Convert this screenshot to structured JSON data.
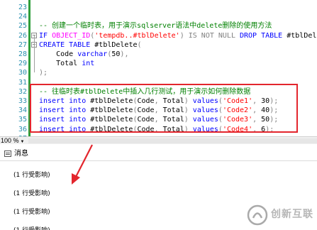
{
  "editor": {
    "lines": [
      {
        "n": "23"
      },
      {
        "n": "24"
      },
      {
        "n": "25",
        "parts": [
          {
            "t": "-- 创建一个临时表，用于演示sqlserver语法中delete删除的使用方法",
            "c": "cm"
          }
        ]
      },
      {
        "n": "26",
        "parts": [
          {
            "t": "IF ",
            "c": "kw"
          },
          {
            "t": "OBJECT_ID",
            "c": "fn"
          },
          {
            "t": "(",
            "c": "gr"
          },
          {
            "t": "'tempdb..#tblDelete'",
            "c": "str"
          },
          {
            "t": ") ",
            "c": "gr"
          },
          {
            "t": "IS NOT NULL ",
            "c": "gr"
          },
          {
            "t": "DROP TABLE ",
            "c": "kw"
          },
          {
            "t": "#tblDelete;",
            "c": "num"
          }
        ]
      },
      {
        "n": "27",
        "parts": [
          {
            "t": "CREATE TABLE ",
            "c": "kw"
          },
          {
            "t": "#tblDelete",
            "c": "num"
          },
          {
            "t": "(",
            "c": "gr"
          }
        ]
      },
      {
        "n": "28",
        "parts": [
          {
            "t": "    Code ",
            "c": "num"
          },
          {
            "t": "varchar",
            "c": "kw"
          },
          {
            "t": "(",
            "c": "gr"
          },
          {
            "t": "50",
            "c": "num"
          },
          {
            "t": "),",
            "c": "gr"
          }
        ]
      },
      {
        "n": "29",
        "parts": [
          {
            "t": "    Total ",
            "c": "num"
          },
          {
            "t": "int",
            "c": "kw"
          }
        ]
      },
      {
        "n": "30",
        "parts": [
          {
            "t": ");",
            "c": "gr"
          }
        ]
      },
      {
        "n": "31"
      },
      {
        "n": "32",
        "parts": [
          {
            "t": "-- 往临时表#tblDelete中插入几行测试，用于演示如何删除数据",
            "c": "cm"
          }
        ]
      },
      {
        "n": "33",
        "parts": [
          {
            "t": "insert into ",
            "c": "kw"
          },
          {
            "t": "#tblDelete",
            "c": "num"
          },
          {
            "t": "(",
            "c": "gr"
          },
          {
            "t": "Code",
            "c": "num"
          },
          {
            "t": ", ",
            "c": "gr"
          },
          {
            "t": "Total",
            "c": "num"
          },
          {
            "t": ") ",
            "c": "gr"
          },
          {
            "t": "values",
            "c": "kw"
          },
          {
            "t": "(",
            "c": "gr"
          },
          {
            "t": "'Code1'",
            "c": "str"
          },
          {
            "t": ", ",
            "c": "gr"
          },
          {
            "t": "30",
            "c": "num"
          },
          {
            "t": ");",
            "c": "gr"
          }
        ]
      },
      {
        "n": "34",
        "parts": [
          {
            "t": "insert into ",
            "c": "kw"
          },
          {
            "t": "#tblDelete",
            "c": "num"
          },
          {
            "t": "(",
            "c": "gr"
          },
          {
            "t": "Code",
            "c": "num"
          },
          {
            "t": ", ",
            "c": "gr"
          },
          {
            "t": "Total",
            "c": "num"
          },
          {
            "t": ") ",
            "c": "gr"
          },
          {
            "t": "values",
            "c": "kw"
          },
          {
            "t": "(",
            "c": "gr"
          },
          {
            "t": "'Code2'",
            "c": "str"
          },
          {
            "t": ", ",
            "c": "gr"
          },
          {
            "t": "40",
            "c": "num"
          },
          {
            "t": ");",
            "c": "gr"
          }
        ]
      },
      {
        "n": "35",
        "parts": [
          {
            "t": "insert into ",
            "c": "kw"
          },
          {
            "t": "#tblDelete",
            "c": "num"
          },
          {
            "t": "(",
            "c": "gr"
          },
          {
            "t": "Code",
            "c": "num"
          },
          {
            "t": ", ",
            "c": "gr"
          },
          {
            "t": "Total",
            "c": "num"
          },
          {
            "t": ") ",
            "c": "gr"
          },
          {
            "t": "values",
            "c": "kw"
          },
          {
            "t": "(",
            "c": "gr"
          },
          {
            "t": "'Code3'",
            "c": "str"
          },
          {
            "t": ", ",
            "c": "gr"
          },
          {
            "t": "50",
            "c": "num"
          },
          {
            "t": ");",
            "c": "gr"
          }
        ]
      },
      {
        "n": "36",
        "parts": [
          {
            "t": "insert into ",
            "c": "kw"
          },
          {
            "t": "#tblDelete",
            "c": "num"
          },
          {
            "t": "(",
            "c": "gr"
          },
          {
            "t": "Code",
            "c": "num"
          },
          {
            "t": ", ",
            "c": "gr"
          },
          {
            "t": "Total",
            "c": "num"
          },
          {
            "t": ") ",
            "c": "gr"
          },
          {
            "t": "values",
            "c": "kw"
          },
          {
            "t": "(",
            "c": "gr"
          },
          {
            "t": "'Code4'",
            "c": "str"
          },
          {
            "t": ", ",
            "c": "gr"
          },
          {
            "t": "6",
            "c": "num"
          },
          {
            "t": ");",
            "c": "gr"
          }
        ]
      },
      {
        "n": "37"
      }
    ]
  },
  "zoom": {
    "value": "100 %",
    "dropdown_icon": "caret-down-icon"
  },
  "results": {
    "tab_label": "消息",
    "tab_icon": "messages-icon",
    "messages": [
      "(1 行受影响)",
      "(1 行受影响)",
      "(1 行受影响)",
      "(1 行受影响)"
    ]
  },
  "annotation": {
    "highlight_color": "#e3262d",
    "arrow_color": "#e3262d"
  },
  "watermark": {
    "text": "创新互联",
    "logo": "brand-logo-icon",
    "color": "#aaaaaa"
  },
  "colors": {
    "keyword": "#0000ff",
    "function": "#ff00ff",
    "string": "#ff0000",
    "comment": "#008000",
    "operator": "#808080",
    "line_number": "#2b91af"
  }
}
